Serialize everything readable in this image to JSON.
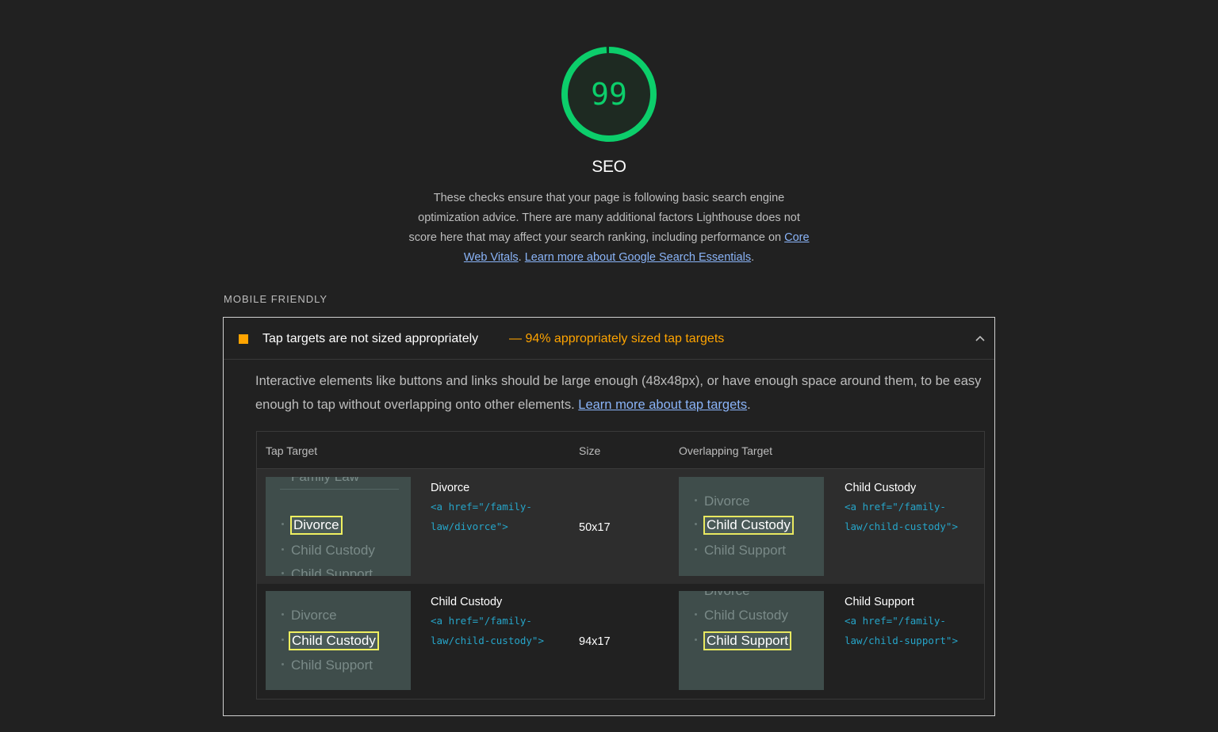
{
  "category": {
    "score": "99",
    "title": "SEO",
    "description_text": "These checks ensure that your page is following basic search engine optimization advice. There are many additional factors Lighthouse does not score here that may affect your search ranking, including performance on ",
    "link_core_web_vitals": "Core Web Vitals",
    "separator": ". ",
    "link_learn_more": "Learn more about Google Search Essentials",
    "period": ".",
    "score_color": "#0cce6b",
    "score_fraction": 0.99
  },
  "group": {
    "title": "MOBILE FRIENDLY"
  },
  "audit": {
    "title": "Tap targets are not sized appropriately",
    "display_value": "— 94% appropriately sized tap targets",
    "status_color": "#ffa400",
    "expanded_icon": "chevron-up-icon",
    "description_text": "Interactive elements like buttons and links should be large enough (48x48px), or have enough space around them, to be easy enough to tap without overlapping onto other elements. ",
    "learn_more_link": "Learn more about tap targets",
    "period": "."
  },
  "table": {
    "headers": {
      "tap_target": "Tap Target",
      "size": "Size",
      "overlapping_target": "Overlapping Target"
    },
    "rows": [
      {
        "target_label": "Divorce",
        "target_code_1": "<a href=\"/family-",
        "target_code_2": "law/divorce\">",
        "size": "50x17",
        "overlap_label": "Child Custody",
        "overlap_code_1": "<a href=\"/family-",
        "overlap_code_2": "law/child-custody\">",
        "target_shot": {
          "above": "Family Law",
          "highlight": "Divorce",
          "below": "Child Custody",
          "below2": "Child Support"
        },
        "overlap_shot": {
          "above": "Divorce",
          "highlight": "Child Custody",
          "below": "Child Support"
        }
      },
      {
        "target_label": "Child Custody",
        "target_code_1": "<a href=\"/family-",
        "target_code_2": "law/child-custody\">",
        "size": "94x17",
        "overlap_label": "Child Support",
        "overlap_code_1": "<a href=\"/family-",
        "overlap_code_2": "law/child-support\">",
        "target_shot": {
          "above": "Divorce",
          "highlight": "Child Custody",
          "below": "Child Support"
        },
        "overlap_shot": {
          "above0": "Divorce",
          "above": "Child Custody",
          "highlight": "Child Support"
        }
      }
    ]
  }
}
